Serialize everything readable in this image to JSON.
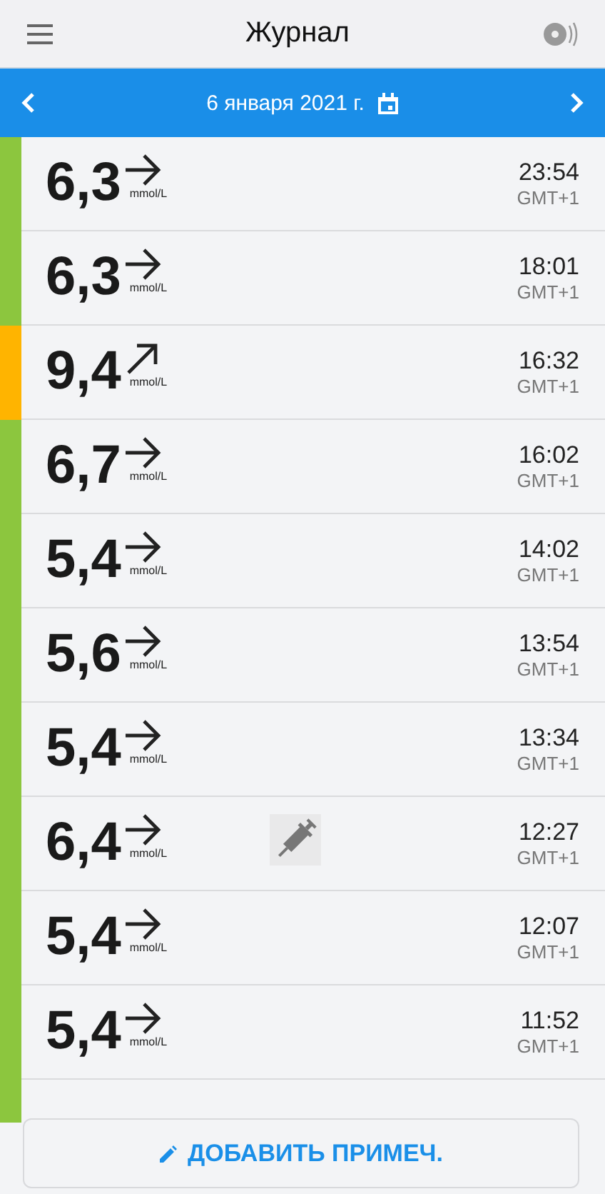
{
  "header": {
    "title": "Журнал"
  },
  "date_bar": {
    "date": "6 января 2021 г."
  },
  "readings": [
    {
      "value": "6,3",
      "kind": "flat",
      "unit": "mmol/L",
      "time": "23:54",
      "timezone": "GMT+1",
      "color": "#8cc63e",
      "insulin": false
    },
    {
      "value": "6,3",
      "kind": "flat",
      "unit": "mmol/L",
      "time": "18:01",
      "timezone": "GMT+1",
      "color": "#8cc63e",
      "insulin": false
    },
    {
      "value": "9,4",
      "kind": "up",
      "unit": "mmol/L",
      "time": "16:32",
      "timezone": "GMT+1",
      "color": "#ffb400",
      "insulin": false
    },
    {
      "value": "6,7",
      "kind": "flat",
      "unit": "mmol/L",
      "time": "16:02",
      "timezone": "GMT+1",
      "color": "#8cc63e",
      "insulin": false
    },
    {
      "value": "5,4",
      "kind": "flat",
      "unit": "mmol/L",
      "time": "14:02",
      "timezone": "GMT+1",
      "color": "#8cc63e",
      "insulin": false
    },
    {
      "value": "5,6",
      "kind": "flat",
      "unit": "mmol/L",
      "time": "13:54",
      "timezone": "GMT+1",
      "color": "#8cc63e",
      "insulin": false
    },
    {
      "value": "5,4",
      "kind": "flat",
      "unit": "mmol/L",
      "time": "13:34",
      "timezone": "GMT+1",
      "color": "#8cc63e",
      "insulin": false
    },
    {
      "value": "6,4",
      "kind": "flat",
      "unit": "mmol/L",
      "time": "12:27",
      "timezone": "GMT+1",
      "color": "#8cc63e",
      "insulin": true
    },
    {
      "value": "5,4",
      "kind": "flat",
      "unit": "mmol/L",
      "time": "12:07",
      "timezone": "GMT+1",
      "color": "#8cc63e",
      "insulin": false
    },
    {
      "value": "5,4",
      "kind": "flat",
      "unit": "mmol/L",
      "time": "11:52",
      "timezone": "GMT+1",
      "color": "#8cc63e",
      "insulin": false
    }
  ],
  "add_note_button": {
    "label": "ДОБАВИТЬ ПРИМЕЧ."
  }
}
